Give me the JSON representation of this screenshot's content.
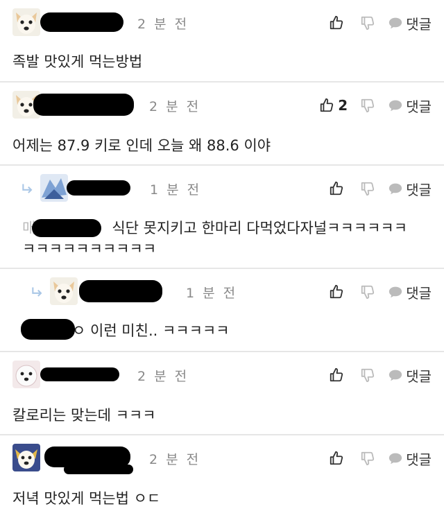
{
  "comments": [
    {
      "time": "2 분 전",
      "like_count": "",
      "reply_label": "댓글",
      "text": "족발 맛있게 먹는방법"
    },
    {
      "time": "2 분 전",
      "like_count": "2",
      "reply_label": "댓글",
      "text": "어제는 87.9 키로 인데 오늘 왜 88.6 이야"
    },
    {
      "time": "1 분 전",
      "like_count": "",
      "reply_label": "댓글",
      "text_prefix": "매",
      "text_line1": "식단 못지키고 한마리 다먹었다자널ㅋㅋㅋㅋㅋㅋ",
      "text_line2": "ㅋㅋㅋㅋㅋㅋㅋㅋㅋㅋ"
    },
    {
      "time": "1 분 전",
      "like_count": "",
      "reply_label": "댓글",
      "text": "ㅇ 이런 미친.. ㅋㅋㅋㅋㅋ"
    },
    {
      "time": "2 분 전",
      "like_count": "",
      "reply_label": "댓글",
      "text": "칼로리는 맞는데 ㅋㅋㅋ"
    },
    {
      "time": "2 분 전",
      "like_count": "",
      "reply_label": "댓글",
      "text": "저녁 맛있게 먹는법 ㅇㄷ"
    }
  ],
  "icons": {
    "like": "thumbs-up-icon",
    "dislike": "thumbs-down-icon",
    "reply": "speech-bubble-icon",
    "reply_arrow": "reply-arrow-icon"
  },
  "colors": {
    "divider": "#e6e6e6",
    "time": "#888888",
    "icon": "#333333",
    "icon_faint": "#bbbbbb"
  }
}
